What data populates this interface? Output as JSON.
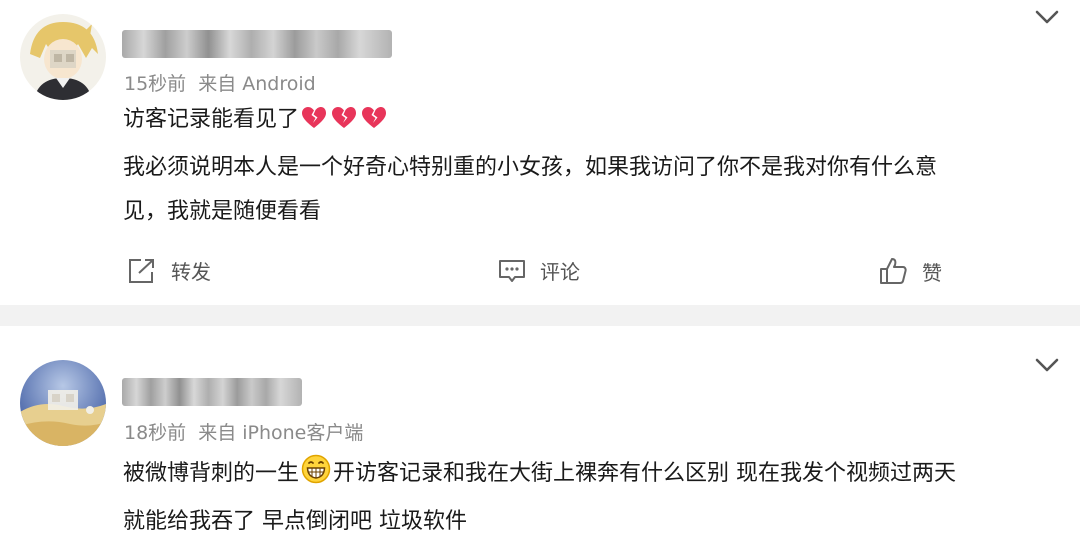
{
  "posts": [
    {
      "time": "15秒前",
      "source": "来自 Android",
      "line1": "访客记录能看见了",
      "line1_emojis": [
        "broken-heart",
        "broken-heart",
        "broken-heart"
      ],
      "line2": "我必须说明本人是一个好奇心特别重的小女孩，如果我访问了你不是我对你有什么意",
      "line3": "见，我就是随便看看",
      "actions": {
        "repost": "转发",
        "comment": "评论",
        "like": "赞"
      }
    },
    {
      "time": "18秒前",
      "source": "来自 iPhone客户端",
      "line1_before": "被微博背刺的一生",
      "line1_emoji": "grinning-face",
      "line1_after": "开访客记录和我在大街上裸奔有什么区别 现在我发个视频过两天",
      "line2": "就能给我吞了 早点倒闭吧 垃圾软件"
    }
  ],
  "colors": {
    "meta_text": "#8a8a8a",
    "separator": "#f2f2f2",
    "broken_heart": "#e8355a"
  }
}
